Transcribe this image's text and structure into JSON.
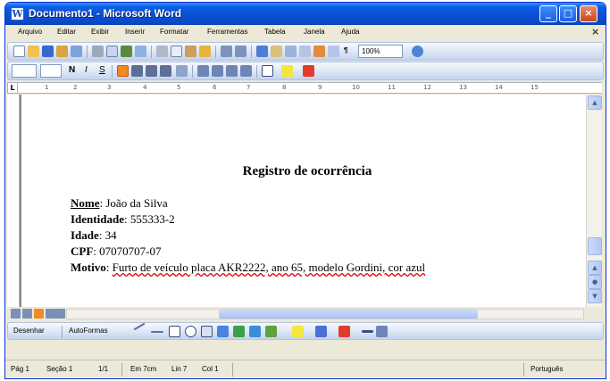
{
  "window": {
    "title": "Documento1 - Microsoft Word",
    "app_icon": "word-doc-icon",
    "buttons": {
      "minimize": "_",
      "maximize": "□",
      "close": "×"
    }
  },
  "menu": {
    "items": [
      "Arquivo",
      "Editar",
      "Exibir",
      "Inserir",
      "Formatar",
      "Ferramentas",
      "Tabela",
      "Janela",
      "Ajuda"
    ],
    "close_doc": "×"
  },
  "standard_toolbar": {
    "zoom_value": "100%",
    "icons": [
      "new-icon",
      "open-icon",
      "save-icon",
      "permission-icon",
      "email-icon",
      "print-icon",
      "print-preview-icon",
      "spelling-icon",
      "research-icon",
      "cut-icon",
      "copy-icon",
      "paste-icon",
      "format-painter-icon",
      "undo-icon",
      "redo-icon",
      "hyperlink-icon",
      "tables-borders-icon",
      "insert-table-icon",
      "columns-icon",
      "drawing-icon",
      "document-map-icon",
      "show-hide-icon",
      "help-icon"
    ]
  },
  "format_toolbar": {
    "style_value": "",
    "font_size_value": "",
    "bold": "N",
    "italic": "I",
    "underline": "S",
    "icons": [
      "align-left-icon",
      "align-center-icon",
      "align-right-icon",
      "justify-icon",
      "line-spacing-icon",
      "numbering-icon",
      "bullets-icon",
      "decrease-indent-icon",
      "increase-indent-icon",
      "outside-border-icon",
      "highlight-icon",
      "font-color-icon"
    ]
  },
  "ruler": {
    "marks": [
      "1",
      "2",
      "3",
      "4",
      "5",
      "6",
      "7",
      "8",
      "9",
      "10",
      "11",
      "12",
      "13",
      "14",
      "15"
    ],
    "tab_selector": "L"
  },
  "document": {
    "heading": "Registro de ocorrência",
    "fields": [
      {
        "label": "Nome",
        "value": "João da Silva"
      },
      {
        "label": "Identidade",
        "value": "555333-2"
      },
      {
        "label": "Idade",
        "value": "34"
      },
      {
        "label": "CPF",
        "value": "07070707-07"
      },
      {
        "label": "Motivo",
        "value": "Furto de veículo placa AKR2222, ano 65, modelo Gordini, cor azul"
      }
    ]
  },
  "drawing_toolbar": {
    "draw_menu": "Desenhar",
    "autoshapes_menu": "AutoFormas"
  },
  "status_bar": {
    "page": "Pág 1",
    "section": "Seção 1",
    "page_count": "1/1",
    "at": "Em 7cm",
    "line": "Lin 7",
    "col": "Col 1",
    "language": "Português"
  },
  "colors": {
    "titlebar": "#0a4fd4",
    "highlight_button": "#f08a24",
    "spelling_underline": "#e00000"
  }
}
